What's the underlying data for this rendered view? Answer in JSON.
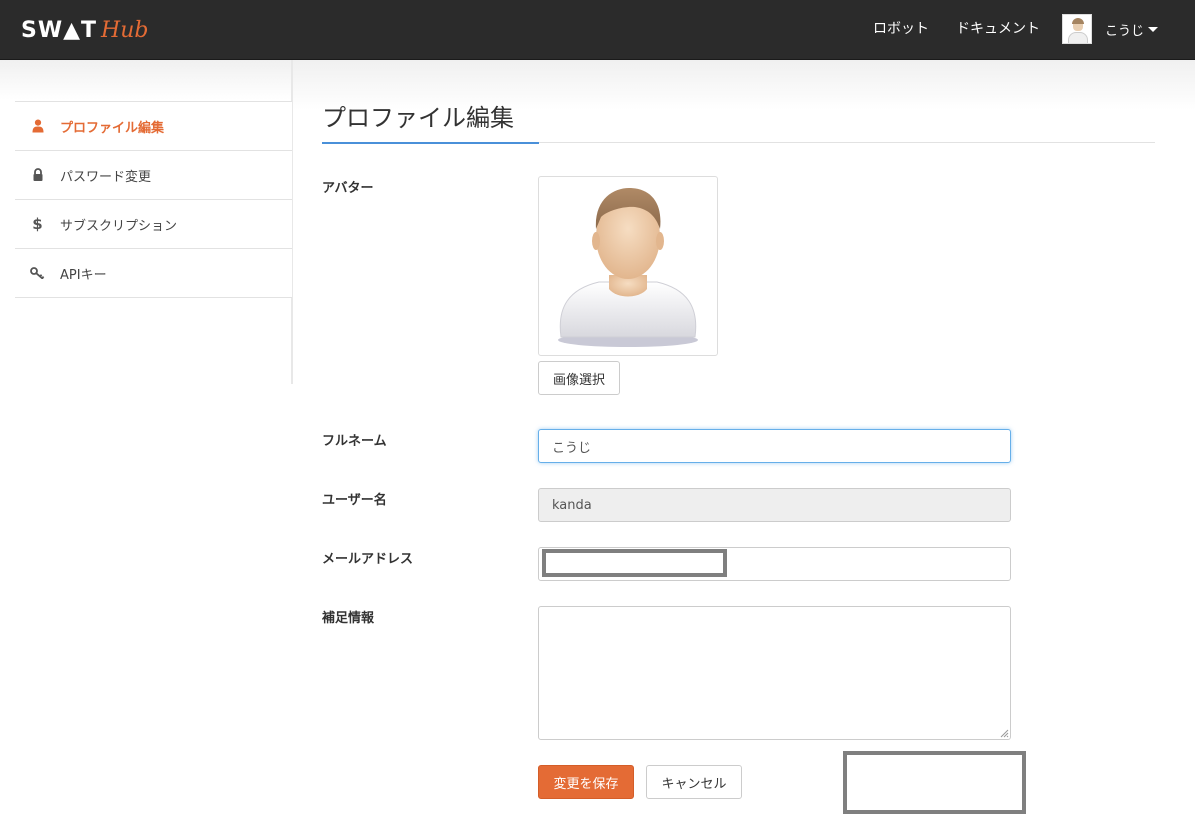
{
  "navbar": {
    "brand_main": "SW▲T",
    "brand_sub": "Hub",
    "links": [
      "ロボット",
      "ドキュメント"
    ],
    "user_name": "こうじ"
  },
  "sidebar": {
    "items": [
      {
        "label": "プロファイル編集",
        "icon": "user-icon",
        "active": true
      },
      {
        "label": "パスワード変更",
        "icon": "lock-icon",
        "active": false
      },
      {
        "label": "サブスクリプション",
        "icon": "dollar-icon",
        "active": false
      },
      {
        "label": "APIキー",
        "icon": "key-icon",
        "active": false
      }
    ]
  },
  "page": {
    "title": "プロファイル編集"
  },
  "form": {
    "avatar_label": "アバター",
    "select_image_label": "画像選択",
    "fullname_label": "フルネーム",
    "fullname_value": "こうじ",
    "username_label": "ユーザー名",
    "username_value": "kanda",
    "email_label": "メールアドレス",
    "notes_label": "補足情報",
    "save_label": "変更を保存",
    "cancel_label": "キャンセル"
  },
  "colors": {
    "accent": "#e46b35",
    "navbar": "#2b2b2b",
    "focus": "#66afe9"
  }
}
